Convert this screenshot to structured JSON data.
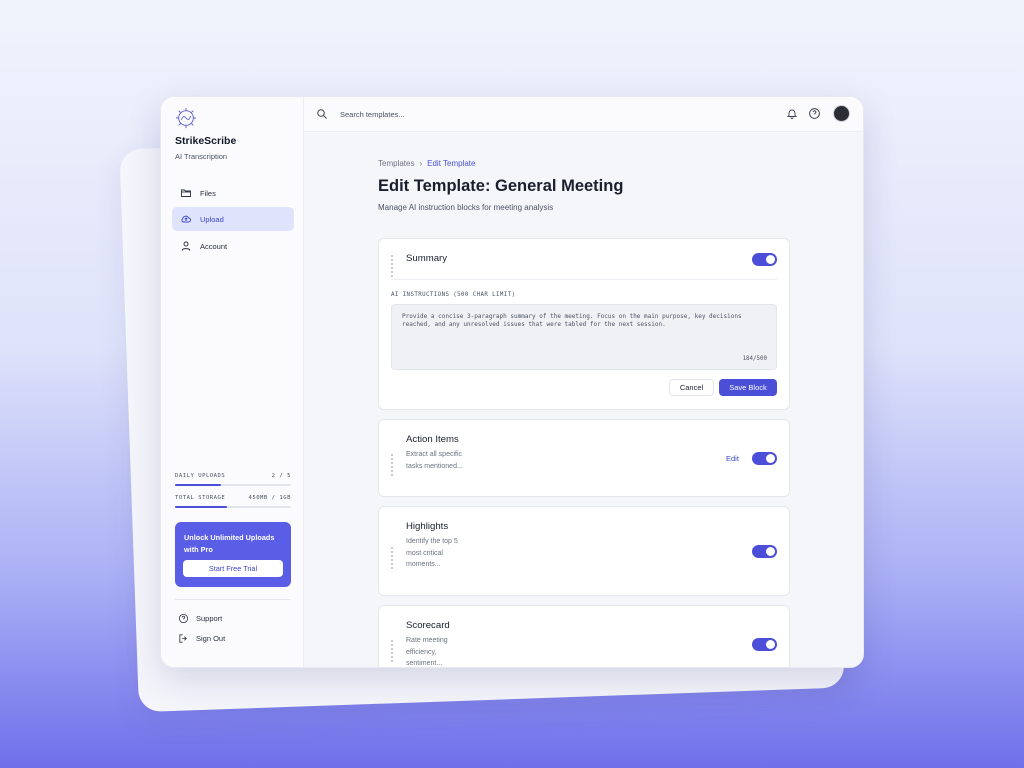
{
  "app": {
    "brand": "StrikeScribe",
    "tagline": "AI Transcription"
  },
  "sidebar": {
    "items": [
      {
        "label": "Files",
        "icon": "folder-icon",
        "active": false
      },
      {
        "label": "Upload",
        "icon": "cloud-upload-icon",
        "active": true
      },
      {
        "label": "Account",
        "icon": "user-icon",
        "active": false
      }
    ],
    "meters": {
      "daily_uploads": {
        "label": "DAILY UPLOADS",
        "value": "2 / 5",
        "fraction": 0.4
      },
      "total_storage": {
        "label": "TOTAL STORAGE",
        "value": "450MB / 1GB",
        "fraction": 0.45
      }
    },
    "promo": {
      "text": "Unlock Unlimited Uploads with Pro",
      "button": "Start Free Trial"
    },
    "footer": [
      {
        "label": "Support",
        "icon": "help-circle-icon"
      },
      {
        "label": "Sign Out",
        "icon": "sign-out-icon"
      }
    ]
  },
  "topbar": {
    "search_placeholder": "Search templates..."
  },
  "page": {
    "breadcrumb": [
      "Templates",
      "Edit Template"
    ],
    "title": "Edit Template: General Meeting",
    "subtitle": "Manage AI instruction blocks for meeting analysis"
  },
  "blocks": [
    {
      "title": "Summary",
      "enabled": true,
      "expanded": true,
      "instructions_label": "AI INSTRUCTIONS (500 CHAR LIMIT)",
      "instructions": "Provide a concise 3-paragraph summary of the meeting. Focus on the main purpose, key decisions reached, and any unresolved issues that were tabled for the next session.",
      "char_count": "184/500",
      "cancel_label": "Cancel",
      "save_label": "Save Block"
    },
    {
      "title": "Action Items",
      "description": "Extract all specific tasks mentioned...",
      "enabled": true,
      "edit_label": "Edit"
    },
    {
      "title": "Highlights",
      "description": "Identify the top 5 most critical moments...",
      "enabled": true
    },
    {
      "title": "Scorecard",
      "description": "Rate meeting efficiency, sentiment...",
      "enabled": true
    }
  ],
  "colors": {
    "accent": "#4b4fd8",
    "active_nav_bg": "#dfe3fb"
  }
}
